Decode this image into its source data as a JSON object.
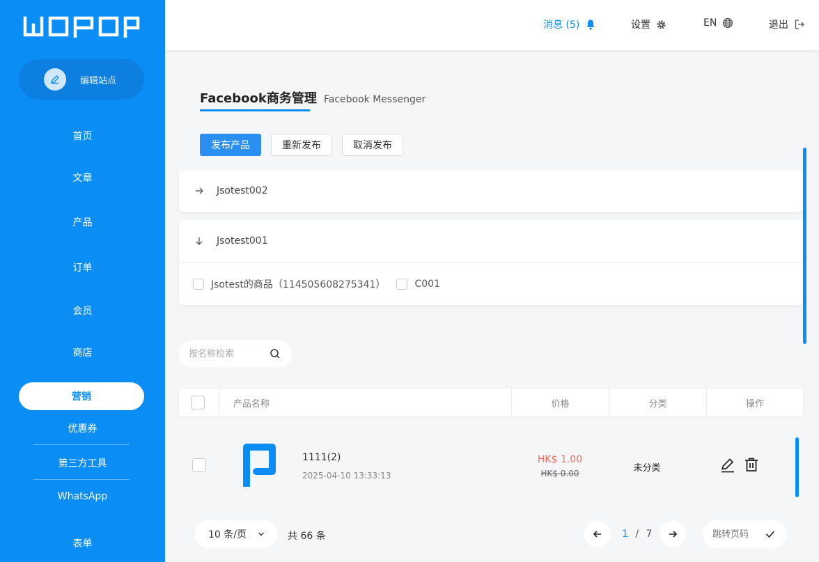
{
  "sidebar": {
    "logo": "WOPOP",
    "edit_site_label": "编辑站点",
    "items": [
      "首页",
      "文章",
      "产品",
      "订单",
      "会员",
      "商店"
    ],
    "active_item": "营销",
    "sub_items": [
      "优惠券",
      "第三方工具",
      "WhatsApp"
    ],
    "last_item": "表单"
  },
  "header": {
    "messages": "消息 (5)",
    "settings": "设置",
    "language": "EN",
    "logout": "退出"
  },
  "tabs": [
    "Facebook商务管理",
    "Facebook Messenger"
  ],
  "actions": [
    "发布产品",
    "重新发布",
    "取消发布"
  ],
  "catalogs": [
    {
      "name": "Jsotest002",
      "expanded": false
    },
    {
      "name": "Jsotest001",
      "expanded": true,
      "options": [
        "Jsotest的商品（114505608275341）",
        "C001"
      ]
    }
  ],
  "search": {
    "placeholder": "按名称检索"
  },
  "table": {
    "columns": [
      "产品名称",
      "价格",
      "分类",
      "操作"
    ],
    "rows": [
      {
        "name": "1111(2)",
        "date": "2025-04-10 13:33:13",
        "price": "HK$ 1.00",
        "original_price": "HK$ 0.00",
        "category": "未分类"
      }
    ]
  },
  "pagination": {
    "page_size": "10 条/页",
    "total": "共 66 条",
    "current": "1",
    "separator": "/",
    "pages": "7",
    "jump_placeholder": "跳转页码"
  },
  "colors": {
    "brand": "#0a8ef5",
    "price": "#f26d5b"
  }
}
